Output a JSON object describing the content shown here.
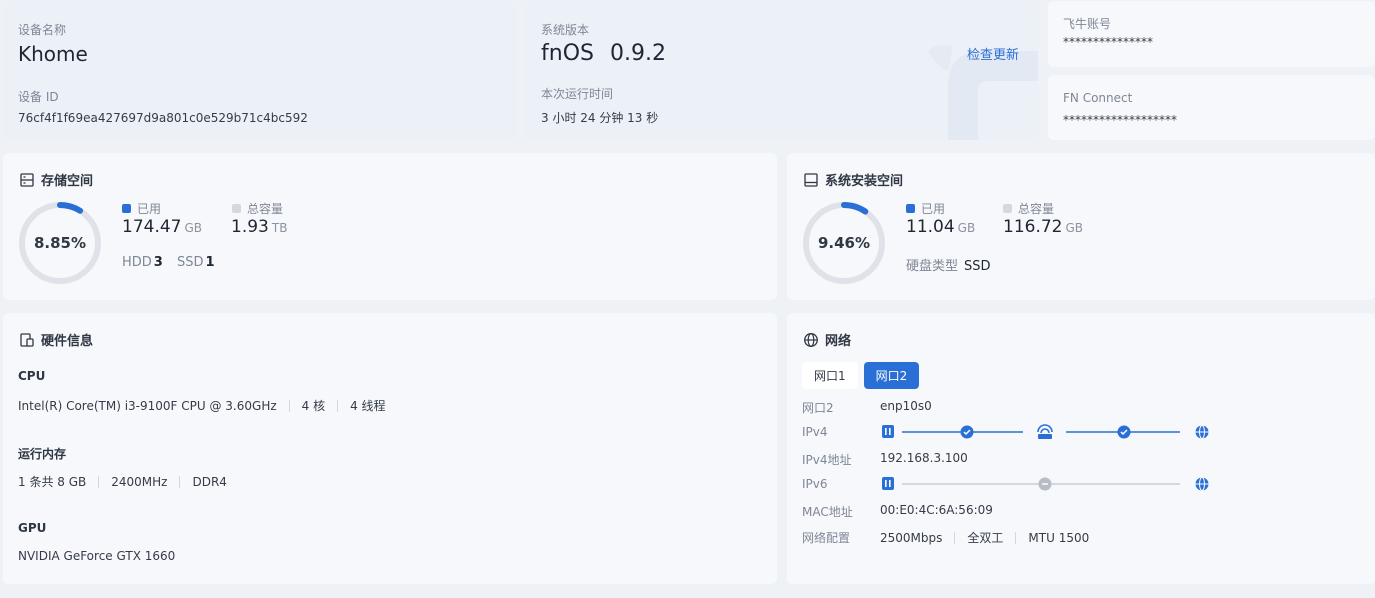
{
  "device": {
    "name_label": "设备名称",
    "name": "Khome",
    "id_label": "设备 ID",
    "id": "76cf4f1f69ea427697d9a801c0e529b71c4bc592"
  },
  "system": {
    "version_label": "系统版本",
    "os": "fnOS",
    "version": "0.9.2",
    "check_update": "检查更新",
    "uptime_label": "本次运行时间",
    "uptime": "3 小时 24 分钟 13 秒"
  },
  "account": {
    "label": "飞牛账号",
    "value": "***************"
  },
  "connect": {
    "label": "FN Connect",
    "value": "*******************"
  },
  "storage": {
    "title": "存储空间",
    "percent_text": "8.85%",
    "percent": 8.85,
    "used_label": "已用",
    "used_value": "174.47",
    "used_unit": "GB",
    "total_label": "总容量",
    "total_value": "1.93",
    "total_unit": "TB",
    "hdd_label": "HDD",
    "hdd_count": "3",
    "ssd_label": "SSD",
    "ssd_count": "1"
  },
  "sysdisk": {
    "title": "系统安装空间",
    "percent_text": "9.46%",
    "percent": 9.46,
    "used_label": "已用",
    "used_value": "11.04",
    "used_unit": "GB",
    "total_label": "总容量",
    "total_value": "116.72",
    "total_unit": "GB",
    "type_label": "硬盘类型",
    "type_value": "SSD"
  },
  "hardware": {
    "title": "硬件信息",
    "cpu_label": "CPU",
    "cpu_model": "Intel(R) Core(TM) i3-9100F CPU @ 3.60GHz",
    "cpu_cores": "4 核",
    "cpu_threads": "4 线程",
    "ram_label": "运行内存",
    "ram_sticks": "1 条共 8 GB",
    "ram_freq": "2400MHz",
    "ram_type": "DDR4",
    "gpu_label": "GPU",
    "gpu_model": "NVIDIA GeForce GTX 1660"
  },
  "network": {
    "title": "网络",
    "tabs": [
      "网口1",
      "网口2"
    ],
    "active_tab": 1,
    "port_label": "网口2",
    "port_value": "enp10s0",
    "ipv4_label": "IPv4",
    "ipv4_addr_label": "IPv4地址",
    "ipv4_addr": "192.168.3.100",
    "ipv6_label": "IPv6",
    "mac_label": "MAC地址",
    "mac": "00:E0:4C:6A:56:09",
    "config_label": "网络配置",
    "speed": "2500Mbps",
    "duplex": "全双工",
    "mtu": "MTU 1500"
  },
  "colors": {
    "accent": "#2a6fd6",
    "track": "#dfe2e8",
    "legend_total": "#d5d8de"
  }
}
